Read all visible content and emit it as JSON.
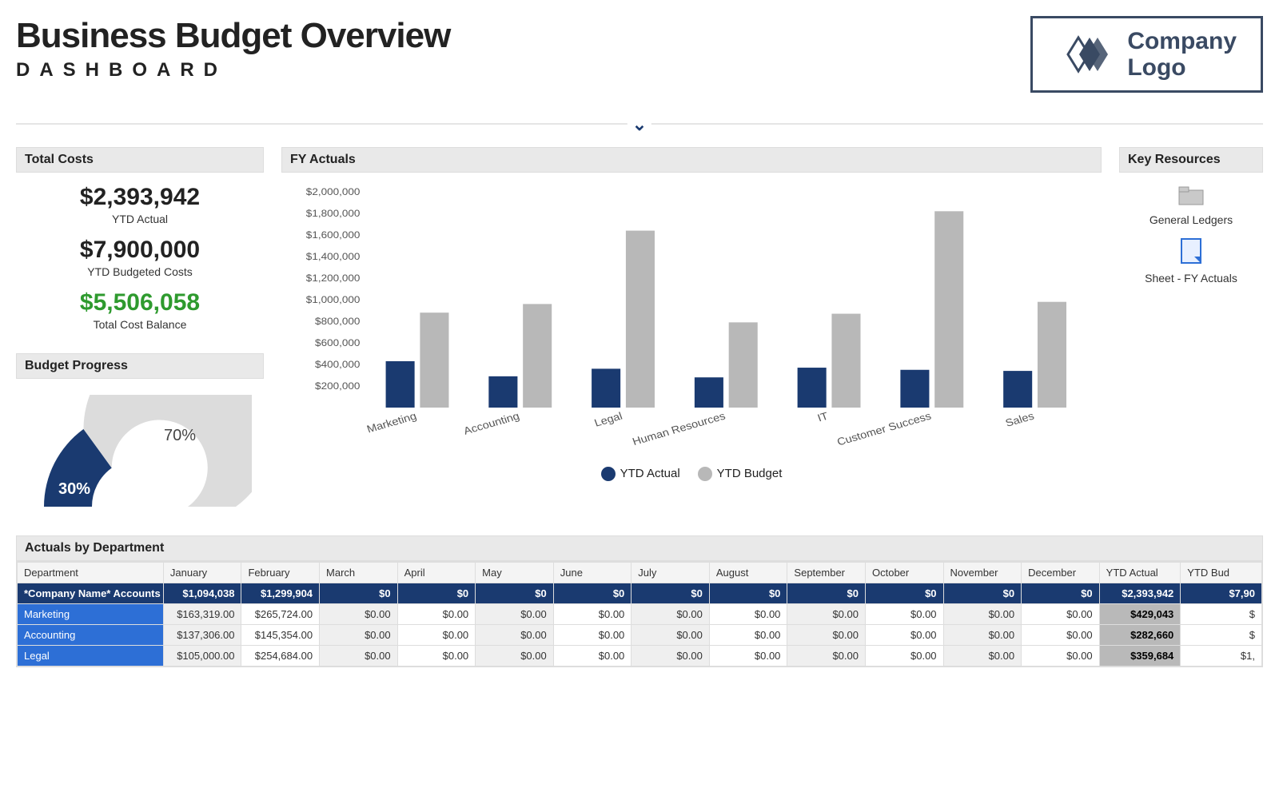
{
  "header": {
    "title": "Business Budget Overview",
    "subtitle": "DASHBOARD",
    "logo_line1": "Company",
    "logo_line2": "Logo"
  },
  "totals": {
    "panel_title": "Total Costs",
    "ytd_actual_value": "$2,393,942",
    "ytd_actual_label": "YTD Actual",
    "ytd_budget_value": "$7,900,000",
    "ytd_budget_label": "YTD Budgeted Costs",
    "balance_value": "$5,506,058",
    "balance_label": "Total Cost Balance"
  },
  "budget_progress": {
    "panel_title": "Budget Progress",
    "used_pct": "30%",
    "remaining_pct": "70%"
  },
  "fy_actuals": {
    "panel_title": "FY Actuals",
    "legend_actual": "YTD Actual",
    "legend_budget": "YTD Budget"
  },
  "resources": {
    "panel_title": "Key Resources",
    "items": [
      {
        "label": "General Ledgers"
      },
      {
        "label": "Sheet - FY Actuals"
      }
    ]
  },
  "table": {
    "panel_title": "Actuals by Department",
    "columns": [
      "Department",
      "January",
      "February",
      "March",
      "April",
      "May",
      "June",
      "July",
      "August",
      "September",
      "October",
      "November",
      "December",
      "YTD Actual",
      "YTD Bud"
    ],
    "total_row": {
      "label": "*Company Name* Accounts",
      "cells": [
        "$1,094,038",
        "$1,299,904",
        "$0",
        "$0",
        "$0",
        "$0",
        "$0",
        "$0",
        "$0",
        "$0",
        "$0",
        "$0",
        "$2,393,942",
        "$7,90"
      ]
    },
    "rows": [
      {
        "label": "Marketing",
        "cells": [
          "$163,319.00",
          "$265,724.00",
          "$0.00",
          "$0.00",
          "$0.00",
          "$0.00",
          "$0.00",
          "$0.00",
          "$0.00",
          "$0.00",
          "$0.00",
          "$0.00",
          "$429,043",
          "$"
        ]
      },
      {
        "label": "Accounting",
        "cells": [
          "$137,306.00",
          "$145,354.00",
          "$0.00",
          "$0.00",
          "$0.00",
          "$0.00",
          "$0.00",
          "$0.00",
          "$0.00",
          "$0.00",
          "$0.00",
          "$0.00",
          "$282,660",
          "$"
        ]
      },
      {
        "label": "Legal",
        "cells": [
          "$105,000.00",
          "$254,684.00",
          "$0.00",
          "$0.00",
          "$0.00",
          "$0.00",
          "$0.00",
          "$0.00",
          "$0.00",
          "$0.00",
          "$0.00",
          "$0.00",
          "$359,684",
          "$1,"
        ]
      }
    ]
  },
  "chart_data": {
    "type": "bar",
    "title": "FY Actuals",
    "xlabel": "",
    "ylabel": "",
    "ylim": [
      0,
      2000000
    ],
    "y_ticks": [
      200000,
      400000,
      600000,
      800000,
      1000000,
      1200000,
      1400000,
      1600000,
      1800000,
      2000000
    ],
    "y_tick_labels": [
      "$200,000",
      "$400,000",
      "$600,000",
      "$800,000",
      "$1,000,000",
      "$1,200,000",
      "$1,400,000",
      "$1,600,000",
      "$1,800,000",
      "$2,000,000"
    ],
    "categories": [
      "Marketing",
      "Accounting",
      "Legal",
      "Human Resources",
      "IT",
      "Customer Success",
      "Sales"
    ],
    "series": [
      {
        "name": "YTD Actual",
        "color": "#1a3a70",
        "values": [
          430000,
          290000,
          360000,
          280000,
          370000,
          350000,
          340000
        ]
      },
      {
        "name": "YTD Budget",
        "color": "#b8b8b8",
        "values": [
          880000,
          960000,
          1640000,
          790000,
          870000,
          1820000,
          980000
        ]
      }
    ]
  },
  "gauge": {
    "used": 30,
    "remaining": 70
  }
}
